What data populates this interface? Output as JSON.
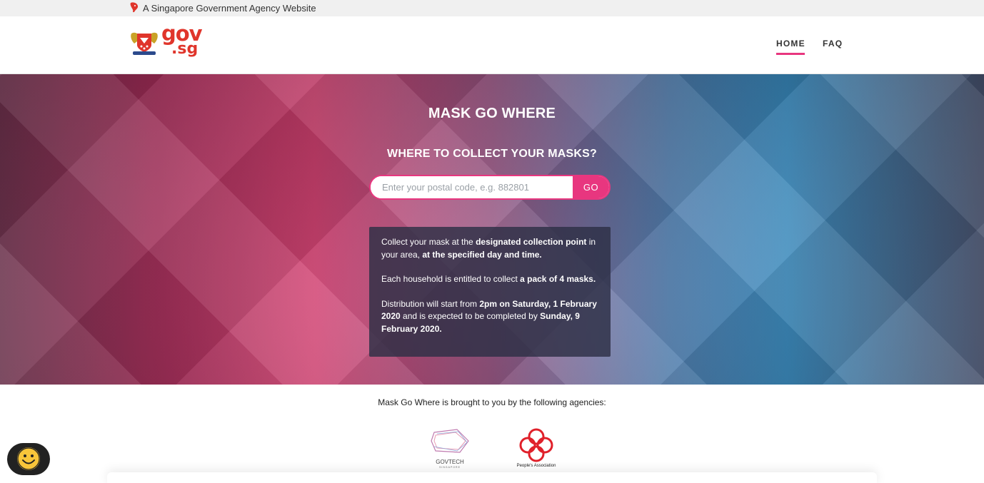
{
  "masthead": {
    "text": "A Singapore Government Agency Website"
  },
  "logo": {
    "line1": "gov",
    "line2": ".sg"
  },
  "nav": {
    "home": "HOME",
    "faq": "FAQ"
  },
  "hero": {
    "title": "MASK GO WHERE",
    "subtitle": "WHERE TO COLLECT YOUR MASKS?",
    "search_placeholder": "Enter your postal code, e.g. 882801",
    "go_label": "GO"
  },
  "info": {
    "p1_a": "Collect your mask at the ",
    "p1_b": "designated collection point",
    "p1_c": " in your area, ",
    "p1_d": "at the specified day and time.",
    "p2_a": "Each household is entitled to collect ",
    "p2_b": "a pack of 4 masks.",
    "p3_a": "Distribution will start from ",
    "p3_b": "2pm on Saturday, 1 February 2020",
    "p3_c": " and is expected to be completed by ",
    "p3_d": "Sunday, 9 February 2020."
  },
  "agencies": {
    "text": "Mask Go Where is brought to you by the following agencies:",
    "govtech_line1": "GOVTECH",
    "govtech_line2": "SINGAPORE",
    "pa_label": "People's Association"
  },
  "colors": {
    "accent": "#e8367f",
    "brand_red": "#e0352b"
  }
}
